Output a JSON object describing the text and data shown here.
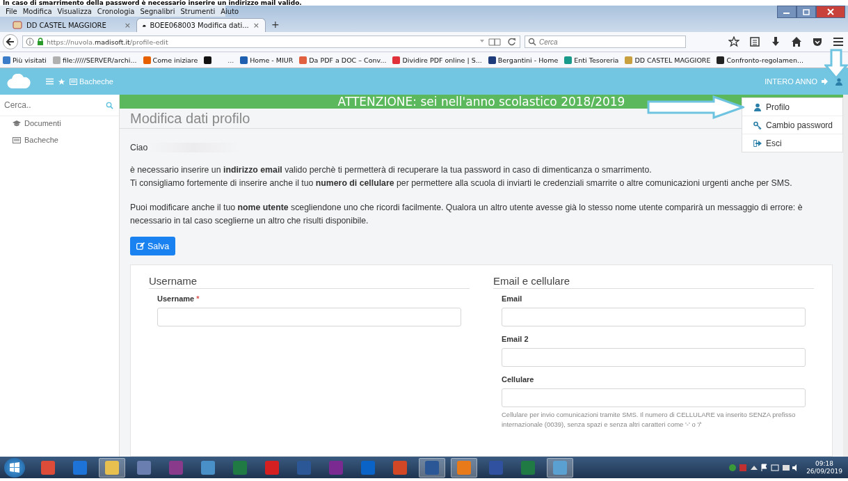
{
  "caption": "In caso di smarrimento della password è necessario inserire un indirizzo mail valido.",
  "menu": [
    "File",
    "Modifica",
    "Visualizza",
    "Cronologia",
    "Segnalibri",
    "Strumenti",
    "Aiuto"
  ],
  "tabs": [
    {
      "label": "DD CASTEL MAGGIORE",
      "selected": false,
      "close": "×"
    },
    {
      "label": "BOEE068003 Modifica dati...",
      "selected": true,
      "close": "×"
    }
  ],
  "new_tab": "+",
  "address": {
    "prefix": "https://nuvola.",
    "domain": "madisoft.it",
    "path": "/profile-edit"
  },
  "search": {
    "placeholder": "Cerca"
  },
  "bookmarks_left": [
    {
      "label": "Più visitati",
      "color": "#3b7bc8"
    },
    {
      "label": "file://///SERVER/archi...",
      "color": "#b0b0b0"
    },
    {
      "label": "Come iniziare",
      "color": "#e66000"
    },
    {
      "color": "#111111"
    }
  ],
  "bookmarks_more": "...",
  "bookmarks_right": [
    {
      "label": "Home - MIUR",
      "color": "#1f5fb0"
    },
    {
      "label": "Da PDF a DOC – Conv...",
      "color": "#e06040"
    },
    {
      "label": "Dividire PDF online | S...",
      "color": "#e0303a"
    },
    {
      "label": "Bergantini - Home",
      "color": "#1d3a7a"
    },
    {
      "label": "Enti Tesoreria",
      "color": "#1a9a8a"
    },
    {
      "label": "DD CASTEL MAGGIORE",
      "color": "#c8a040"
    },
    {
      "label": "Confronto-regolamen...",
      "color": "#222222"
    }
  ],
  "app": {
    "nav_link": "Bacheche",
    "year": "INTERO ANNO"
  },
  "sidebar": {
    "placeholder": "Cerca..",
    "items": [
      {
        "label": "Documenti",
        "kind": "cap"
      },
      {
        "label": "Bacheche",
        "kind": "board"
      }
    ]
  },
  "banner": "ATTENZIONE: sei nell'anno scolastico 2018/2019",
  "title": "Modifica dati profilo",
  "greeting": "Ciao",
  "paragraphs": [
    "è necessario inserire un **indirizzo email** valido perchè ti permetterà di recuperare la tua password in caso di dimenticanza o smarrimento.",
    "Ti consigliamo fortemente di inserire anche il tuo **numero di cellulare** per permettere alla scuola di inviarti le credenziali smarrite o altre comunicazioni urgenti anche per SMS.",
    "Puoi modificare anche il tuo **nome utente** scegliendone uno che ricordi facilmente. Qualora un altro utente avesse già lo stesso nome utente comparirà un messaggio di errore: è necessario in tal caso sceglierne un altro che risulti disponibile."
  ],
  "save_button": "Salva",
  "sections": [
    {
      "heading": "Username",
      "fields": [
        {
          "label": "Username",
          "required_mark": "*"
        }
      ]
    },
    {
      "heading": "Email e cellulare",
      "fields": [
        {
          "label": "Email"
        },
        {
          "label": "Email 2"
        },
        {
          "label": "Cellulare",
          "help": "Cellulare per invio comunicazioni tramite SMS. Il numero di CELLULARE va inserito SENZA prefisso internazionale (0039), senza spazi e senza altri caratteri come '-' o '/'"
        }
      ]
    }
  ],
  "dropdown": [
    {
      "label": "Profilo",
      "kind": "user"
    },
    {
      "label": "Cambio password",
      "kind": "key"
    },
    {
      "label": "Esci",
      "kind": "exit"
    }
  ],
  "taskbar": {
    "apps": [
      {
        "color": "#dd4b39",
        "selected": false
      },
      {
        "color": "#1e73d8",
        "selected": false
      },
      {
        "color": "#e8c050",
        "selected": true
      },
      {
        "color": "#6a7fb0",
        "selected": false
      },
      {
        "color": "#8a3a8a",
        "selected": false
      },
      {
        "color": "#4a90c8",
        "selected": false
      },
      {
        "color": "#1f7a44",
        "selected": false
      },
      {
        "color": "#d42020",
        "selected": false
      },
      {
        "color": "#2b5797",
        "selected": false
      },
      {
        "color": "#7a2a90",
        "selected": false
      },
      {
        "color": "#0a64c8",
        "selected": false
      },
      {
        "color": "#d24726",
        "selected": false
      },
      {
        "color": "#2b5797",
        "selected": true
      },
      {
        "color": "#e87a1a",
        "selected": true
      },
      {
        "color": "#3050a0",
        "selected": false
      },
      {
        "color": "#1f7a44",
        "selected": false
      },
      {
        "color": "#5aa0d0",
        "selected": true
      }
    ],
    "time": "09:18",
    "date": "26/09/2019"
  }
}
